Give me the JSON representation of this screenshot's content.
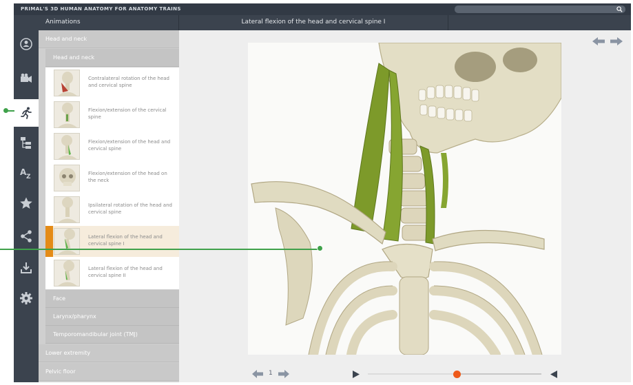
{
  "app": {
    "title": "PRIMAL'S 3D HUMAN ANATOMY FOR ANATOMY TRAINS",
    "search_placeholder": ""
  },
  "header": {
    "section_label": "Animations",
    "title": "Lateral flexion of the head and cervical spine I"
  },
  "sidebar": {
    "icons": [
      "model-icon",
      "video-camera-icon",
      "running-figure-icon",
      "hierarchy-icon",
      "a-z-icon",
      "star-icon",
      "share-icon",
      "download-icon",
      "gear-icon"
    ],
    "active_index": 2
  },
  "list": {
    "category_top": "Head and neck",
    "subcategory": "Head and neck",
    "items": [
      {
        "label": "Contralateral rotation of the head and cervical spine"
      },
      {
        "label": "Flexion/extension of the cervical spine"
      },
      {
        "label": "Flexion/extension of the head and cervical spine"
      },
      {
        "label": "Flexion/extension of the head on the neck"
      },
      {
        "label": "Ipsilateral rotation of the head and cervical spine"
      },
      {
        "label": "Lateral flexion of the head and cervical spine I"
      },
      {
        "label": "Lateral flexion of the head and cervical spine II"
      }
    ],
    "selected_index": 5,
    "subcategories_after": [
      "Face",
      "Larynx/pharynx",
      "Temporomandibular joint (TMJ)"
    ],
    "categories_after": [
      "Lower extremity",
      "Pelvic floor"
    ]
  },
  "player": {
    "page": "1",
    "progress": 0.51
  },
  "colors": {
    "accent": "#e48b17",
    "scrubber": "#ee5a1a",
    "callout": "#3fa14a",
    "chrome": "#3b434e"
  }
}
